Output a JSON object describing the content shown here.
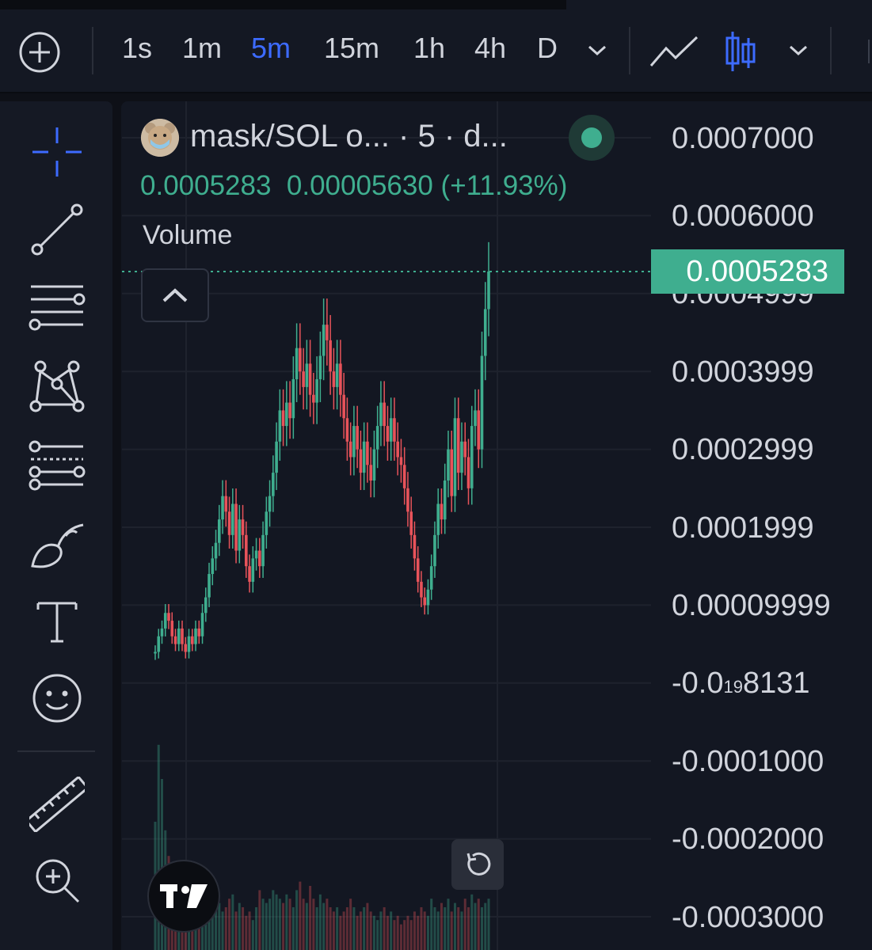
{
  "toolbar": {
    "timeframes": [
      {
        "label": "1s",
        "active": false
      },
      {
        "label": "1m",
        "active": false
      },
      {
        "label": "5m",
        "active": true
      },
      {
        "label": "15m",
        "active": false
      },
      {
        "label": "1h",
        "active": false
      },
      {
        "label": "4h",
        "active": false
      },
      {
        "label": "D",
        "active": false
      }
    ],
    "icons": [
      "add-symbol-icon",
      "chevron-down-icon",
      "line-chart-icon",
      "candlestick-icon",
      "chevron-down-icon"
    ],
    "accent_color": "#3d6bff"
  },
  "sidebar": {
    "tools": [
      "crosshair-icon",
      "trend-line-icon",
      "horizontal-lines-icon",
      "pattern-icon",
      "fib-tool-icon",
      "brush-icon",
      "text-icon",
      "emoji-icon",
      "ruler-icon",
      "zoom-in-icon"
    ]
  },
  "legend": {
    "title": "mask/SOL o...  · 5 · d...",
    "price": "0.0005283",
    "change": "0.00005630 (+11.93%)",
    "volume_label": "Volume",
    "status_color": "#3fae8f"
  },
  "price_axis": {
    "labels": [
      "0.0007000",
      "0.0006000",
      "0.0004999",
      "0.0003999",
      "0.0002999",
      "0.0001999",
      "0.00009999",
      "-0.0",
      "-0.0001000",
      "-0.0002000",
      "-0.0003000"
    ],
    "small_label": {
      "prefix": "-0.0",
      "sub": "19",
      "suffix": "8131"
    },
    "last_price": "0.0005283",
    "up_color": "#3fae8f",
    "down_color": "#e8535a"
  },
  "chart_data": {
    "type": "candlestick",
    "symbol": "mask/SOL",
    "interval": "5",
    "ylim": [
      -0.0003,
      0.0007
    ],
    "last_price": 0.0005283,
    "close": [
      4e-05,
      6e-05,
      7e-05,
      9e-05,
      8e-05,
      6e-05,
      5e-05,
      7e-05,
      5e-05,
      4e-05,
      6e-05,
      5e-05,
      7e-05,
      6e-05,
      9e-05,
      0.00011,
      0.00014,
      0.00016,
      0.00018,
      0.00021,
      0.00024,
      0.00022,
      0.00019,
      0.00023,
      0.00017,
      0.00021,
      0.00019,
      0.00015,
      0.00013,
      0.00016,
      0.00017,
      0.00015,
      0.00019,
      0.00022,
      0.00024,
      0.00027,
      0.00031,
      0.00035,
      0.00033,
      0.00036,
      0.00034,
      0.00039,
      0.00043,
      0.0004,
      0.00038,
      0.00041,
      0.00037,
      0.00036,
      0.00039,
      0.00042,
      0.00046,
      0.00044,
      0.0004,
      0.00038,
      0.00041,
      0.00037,
      0.00034,
      0.00031,
      0.00029,
      0.00033,
      0.0003,
      0.00027,
      0.00031,
      0.00028,
      0.00026,
      0.0003,
      0.00033,
      0.00036,
      0.00033,
      0.00031,
      0.00034,
      0.00031,
      0.00029,
      0.00028,
      0.00025,
      0.00022,
      0.00019,
      0.00016,
      0.00013,
      0.00011,
      0.0001,
      0.00012,
      0.00015,
      0.00019,
      0.00023,
      0.00021,
      0.00026,
      0.0003,
      0.00024,
      0.00034,
      0.00027,
      0.00031,
      0.00029,
      0.00025,
      0.00033,
      0.00035,
      0.0003,
      0.00042,
      0.00048,
      0.0005283
    ],
    "volume": [
      0.3,
      0.48,
      0.4,
      0.28,
      0.22,
      0.2,
      0.18,
      0.15,
      0.12,
      0.1,
      0.14,
      0.12,
      0.1,
      0.16,
      0.11,
      0.13,
      0.1,
      0.12,
      0.14,
      0.11,
      0.09,
      0.1,
      0.12,
      0.13,
      0.09,
      0.11,
      0.1,
      0.08,
      0.09,
      0.07,
      0.1,
      0.14,
      0.12,
      0.11,
      0.12,
      0.14,
      0.13,
      0.12,
      0.11,
      0.13,
      0.12,
      0.1,
      0.14,
      0.16,
      0.12,
      0.11,
      0.15,
      0.12,
      0.1,
      0.13,
      0.11,
      0.12,
      0.1,
      0.09,
      0.1,
      0.08,
      0.09,
      0.1,
      0.12,
      0.1,
      0.08,
      0.09,
      0.1,
      0.11,
      0.09,
      0.08,
      0.07,
      0.09,
      0.1,
      0.08,
      0.09,
      0.07,
      0.08,
      0.06,
      0.07,
      0.08,
      0.07,
      0.09,
      0.08,
      0.1,
      0.09,
      0.08,
      0.12,
      0.1,
      0.09,
      0.11,
      0.1,
      0.12,
      0.09,
      0.11,
      0.1,
      0.09,
      0.12,
      0.1,
      0.13,
      0.11,
      0.12,
      0.1,
      0.11,
      0.12
    ],
    "grid": true
  }
}
